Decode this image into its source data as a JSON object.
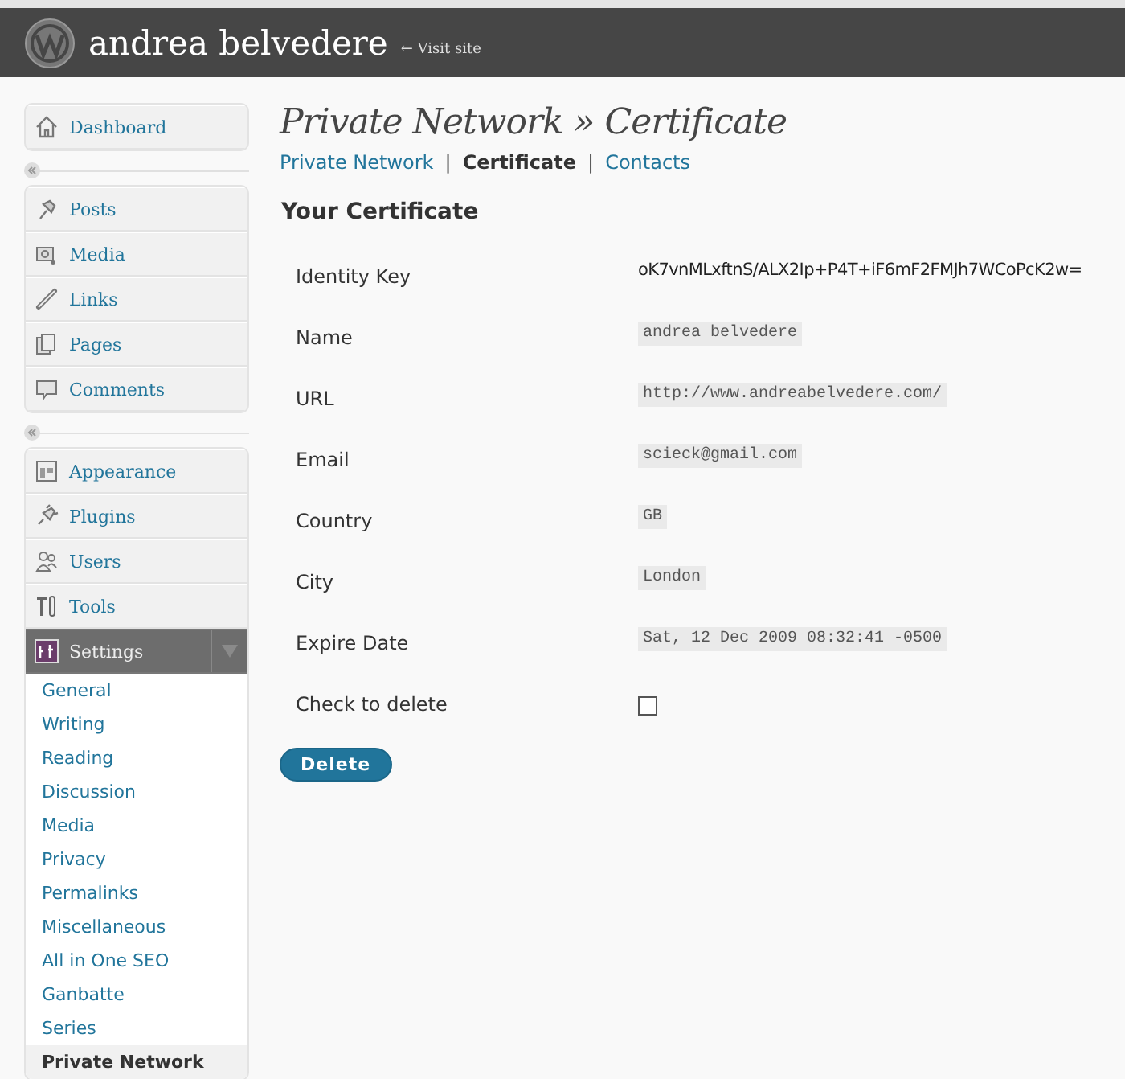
{
  "header": {
    "site_title": "andrea belvedere",
    "visit_link": "← Visit site"
  },
  "sidebar": {
    "groups": [
      [
        {
          "label": "Dashboard",
          "selected": false
        }
      ],
      [
        {
          "label": "Posts",
          "selected": false
        },
        {
          "label": "Media",
          "selected": false
        },
        {
          "label": "Links",
          "selected": false
        },
        {
          "label": "Pages",
          "selected": false
        },
        {
          "label": "Comments",
          "selected": false
        }
      ],
      [
        {
          "label": "Appearance",
          "selected": false
        },
        {
          "label": "Plugins",
          "selected": false
        },
        {
          "label": "Users",
          "selected": false
        },
        {
          "label": "Tools",
          "selected": false
        },
        {
          "label": "Settings",
          "selected": true,
          "expanded": true,
          "children": [
            {
              "label": "General",
              "selected": false
            },
            {
              "label": "Writing",
              "selected": false
            },
            {
              "label": "Reading",
              "selected": false
            },
            {
              "label": "Discussion",
              "selected": false
            },
            {
              "label": "Media",
              "selected": false
            },
            {
              "label": "Privacy",
              "selected": false
            },
            {
              "label": "Permalinks",
              "selected": false
            },
            {
              "label": "Miscellaneous",
              "selected": false
            },
            {
              "label": "All in One SEO",
              "selected": false
            },
            {
              "label": "Ganbatte",
              "selected": false
            },
            {
              "label": "Series",
              "selected": false
            },
            {
              "label": "Private Network",
              "selected": true
            }
          ]
        }
      ]
    ]
  },
  "page_title": "Private Network » Certificate",
  "subnav": [
    {
      "kind": "link",
      "label": "Private Network",
      "selected": false
    },
    {
      "kind": "separator",
      "label": "|"
    },
    {
      "kind": "link",
      "label": "Certificate",
      "selected": true
    },
    {
      "kind": "separator",
      "label": "|"
    },
    {
      "kind": "link",
      "label": "Contacts",
      "selected": false
    }
  ],
  "section_title": "Your Certificate",
  "fields": [
    {
      "label": "Identity Key",
      "kind": "text",
      "value": "oK7vnMLxftnS/ALX2Ip+P4T+iF6mF2FMJh7WCoPcK2w="
    },
    {
      "label": "Name",
      "kind": "code",
      "value": "andrea belvedere"
    },
    {
      "label": "URL",
      "kind": "code",
      "value": "http://www.andreabelvedere.com/"
    },
    {
      "label": "Email",
      "kind": "code",
      "value": "scieck@gmail.com"
    },
    {
      "label": "Country",
      "kind": "code",
      "value": "GB"
    },
    {
      "label": "City",
      "kind": "code",
      "value": "London"
    },
    {
      "label": "Expire Date",
      "kind": "code",
      "value": "Sat, 12 Dec 2009 08:32:41 -0500"
    },
    {
      "label": "Check to delete",
      "kind": "checkbox",
      "checked": false
    }
  ],
  "delete_button": "Delete"
}
